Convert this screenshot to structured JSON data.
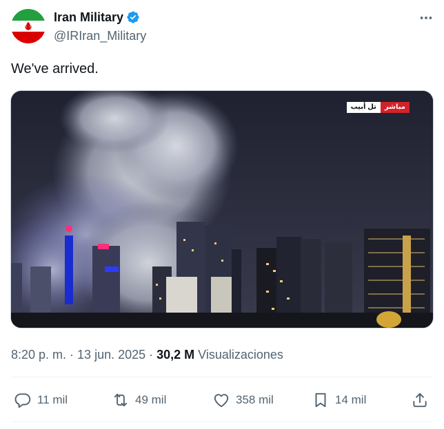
{
  "author": {
    "display_name": "Iran Military",
    "handle": "@IRIran_Military",
    "avatar_icon": "iran-flag",
    "verified": true,
    "verified_color": "#1d9bf0"
  },
  "tweet": {
    "text": "We've arrived."
  },
  "media": {
    "badge_city": "تل أبيب",
    "badge_live": "مباشر"
  },
  "meta": {
    "time": "8:20 p. m.",
    "sep1": " · ",
    "date": "13 jun. 2025",
    "sep2": " · ",
    "views_count": "30,2 M",
    "views_label": " Visualizaciones"
  },
  "actions": {
    "replies": "11 mil",
    "reposts": "49 mil",
    "likes": "358 mil",
    "bookmarks": "14 mil"
  },
  "colors": {
    "text_primary": "#0f1419",
    "text_secondary": "#536471",
    "divider": "#eff3f4",
    "live_red": "#d2232a"
  }
}
